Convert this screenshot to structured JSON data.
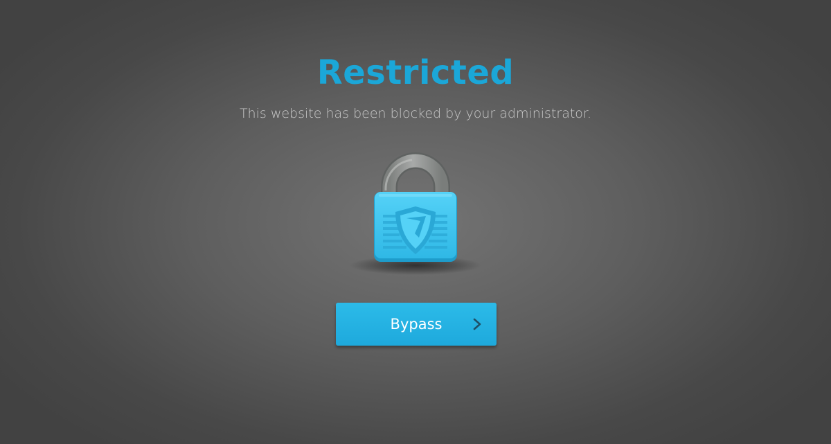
{
  "header": {
    "title": "Restricted",
    "subtitle": "This website has been blocked by your administrator."
  },
  "lock": {
    "icon": "padlock-shield-icon"
  },
  "bypass": {
    "label": "Bypass",
    "icon": "chevron-right-icon"
  },
  "colors": {
    "accent": "#1ba7d8",
    "button": "#23b0e0",
    "shackle": "#8e918f",
    "lock_body": "#3cc5f0",
    "subtitle": "#c8c8c8"
  }
}
